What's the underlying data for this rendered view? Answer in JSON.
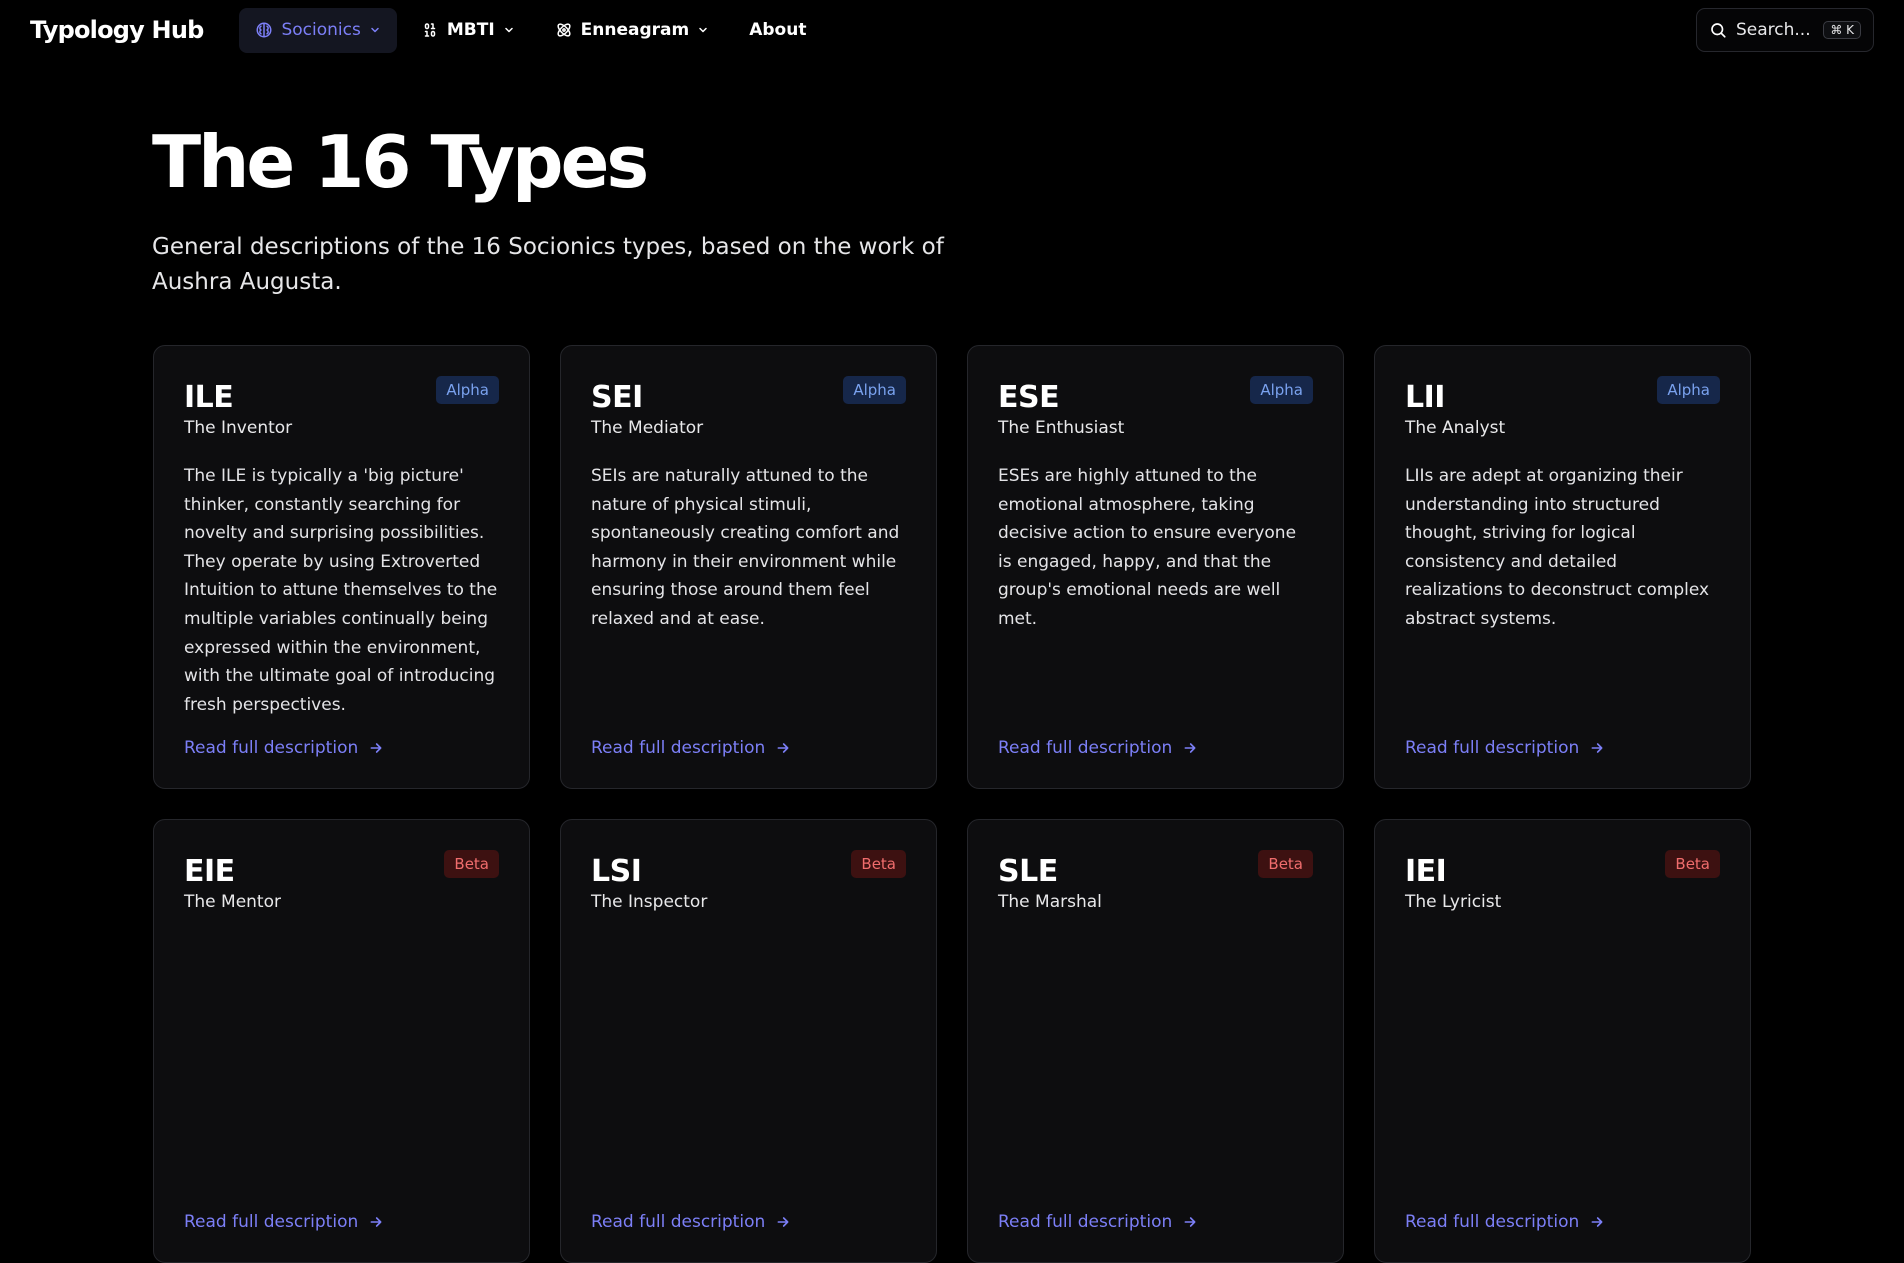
{
  "nav": {
    "brand": "Typology Hub",
    "items": [
      {
        "label": "Socionics",
        "icon": "brain-icon",
        "dropdown": true,
        "active": true
      },
      {
        "label": "MBTI",
        "icon": "binary-icon",
        "dropdown": true,
        "active": false
      },
      {
        "label": "Enneagram",
        "icon": "atom-icon",
        "dropdown": true,
        "active": false
      },
      {
        "label": "About",
        "dropdown": false,
        "active": false
      }
    ],
    "search": {
      "label": "Search...",
      "shortcut": "⌘ K"
    }
  },
  "hero": {
    "title": "The 16 Types",
    "subtitle": "General descriptions of the 16 Socionics types, based on the work of Aushra Augusta."
  },
  "read_more_label": "Read full description",
  "cards": [
    {
      "code": "ILE",
      "nickname": "The Inventor",
      "quadra": "Alpha",
      "description": "The ILE is typically a 'big picture' thinker, constantly searching for novelty and surprising possibilities. They operate by using Extroverted Intuition to attune themselves to the multiple variables continually being expressed within the environment, with the ultimate goal of introducing fresh perspectives."
    },
    {
      "code": "SEI",
      "nickname": "The Mediator",
      "quadra": "Alpha",
      "description": "SEIs are naturally attuned to the nature of physical stimuli, spontaneously creating comfort and harmony in their environment while ensuring those around them feel relaxed and at ease."
    },
    {
      "code": "ESE",
      "nickname": "The Enthusiast",
      "quadra": "Alpha",
      "description": "ESEs are highly attuned to the emotional atmosphere, taking decisive action to ensure everyone is engaged, happy, and that the group's emotional needs are well met."
    },
    {
      "code": "LII",
      "nickname": "The Analyst",
      "quadra": "Alpha",
      "description": "LIIs are adept at organizing their understanding into structured thought, striving for logical consistency and detailed realizations to deconstruct complex abstract systems."
    },
    {
      "code": "EIE",
      "nickname": "The Mentor",
      "quadra": "Beta",
      "description": ""
    },
    {
      "code": "LSI",
      "nickname": "The Inspector",
      "quadra": "Beta",
      "description": ""
    },
    {
      "code": "SLE",
      "nickname": "The Marshal",
      "quadra": "Beta",
      "description": ""
    },
    {
      "code": "IEI",
      "nickname": "The Lyricist",
      "quadra": "Beta",
      "description": ""
    }
  ],
  "colors": {
    "background": "#000000",
    "card": "#0d0d0f",
    "accent": "#7c7ff7",
    "alpha_badge_bg": "#16274a",
    "alpha_badge_text": "#7aa2ef",
    "beta_badge_bg": "#3d1111",
    "beta_badge_text": "#f06d6d"
  }
}
